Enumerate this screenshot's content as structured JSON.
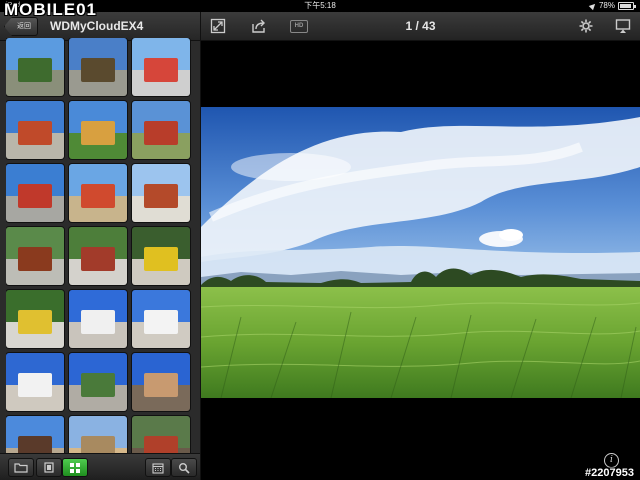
{
  "status": {
    "carrier": "iPad",
    "time": "下午5:18",
    "battery": "78%"
  },
  "watermark": {
    "logo": "MOBILE01",
    "post_id": "#2207953"
  },
  "sidebar": {
    "back_label": "返回",
    "title": "WDMyCloudEX4",
    "thumbnails": [
      {
        "sky": "#5b9be0",
        "ground": "#8a8f7a",
        "obj": "#3e6b2e"
      },
      {
        "sky": "#4a7fc8",
        "ground": "#9a9a90",
        "obj": "#5a4a2e"
      },
      {
        "sky": "#7fb5ea",
        "ground": "#cfcfcf",
        "obj": "#d6463a"
      },
      {
        "sky": "#3f7dd0",
        "ground": "#b9b6aa",
        "obj": "#c04a2a"
      },
      {
        "sky": "#4a8ad8",
        "ground": "#4f8a36",
        "obj": "#d8a040"
      },
      {
        "sky": "#5a92d6",
        "ground": "#8aa060",
        "obj": "#b83d2a"
      },
      {
        "sky": "#3b7ed2",
        "ground": "#a7a7a2",
        "obj": "#c0392b"
      },
      {
        "sky": "#6aa6e4",
        "ground": "#c8b48c",
        "obj": "#d04a2e"
      },
      {
        "sky": "#9cc4ee",
        "ground": "#e0ddd4",
        "obj": "#b44a2a"
      },
      {
        "sky": "#5a8a4a",
        "ground": "#bdbdb6",
        "obj": "#8a3a1e"
      },
      {
        "sky": "#4d7e3a",
        "ground": "#d4d2cc",
        "obj": "#a23b2a"
      },
      {
        "sky": "#3a5e2e",
        "ground": "#cfcac0",
        "obj": "#e0c020"
      },
      {
        "sky": "#3a6e2c",
        "ground": "#d8d6d0",
        "obj": "#e0c030"
      },
      {
        "sky": "#2f6bd8",
        "ground": "#c9c4bc",
        "obj": "#f0f0f0"
      },
      {
        "sky": "#3b78dc",
        "ground": "#d0cbc2",
        "obj": "#f3f3f3"
      },
      {
        "sky": "#2e68d2",
        "ground": "#cfc9bf",
        "obj": "#f2f2f2"
      },
      {
        "sky": "#2c66d4",
        "ground": "#b0aca4",
        "obj": "#4a7a3a"
      },
      {
        "sky": "#2a64d2",
        "ground": "#7a6a5a",
        "obj": "#c89a70"
      },
      {
        "sky": "#4c8adc",
        "ground": "#b8a890",
        "obj": "#5a3a2a"
      },
      {
        "sky": "#8ab2e2",
        "ground": "#d6b88a",
        "obj": "#a88a60"
      },
      {
        "sky": "#5a7a4a",
        "ground": "#6a5a4a",
        "obj": "#b0402a"
      }
    ]
  },
  "topbar": {
    "current": "1",
    "total": "43",
    "counter_text": "1 / 43",
    "hd_label": "HD"
  },
  "colors": {
    "accent_green": "#3fb43f",
    "bar_dark": "#262626"
  }
}
